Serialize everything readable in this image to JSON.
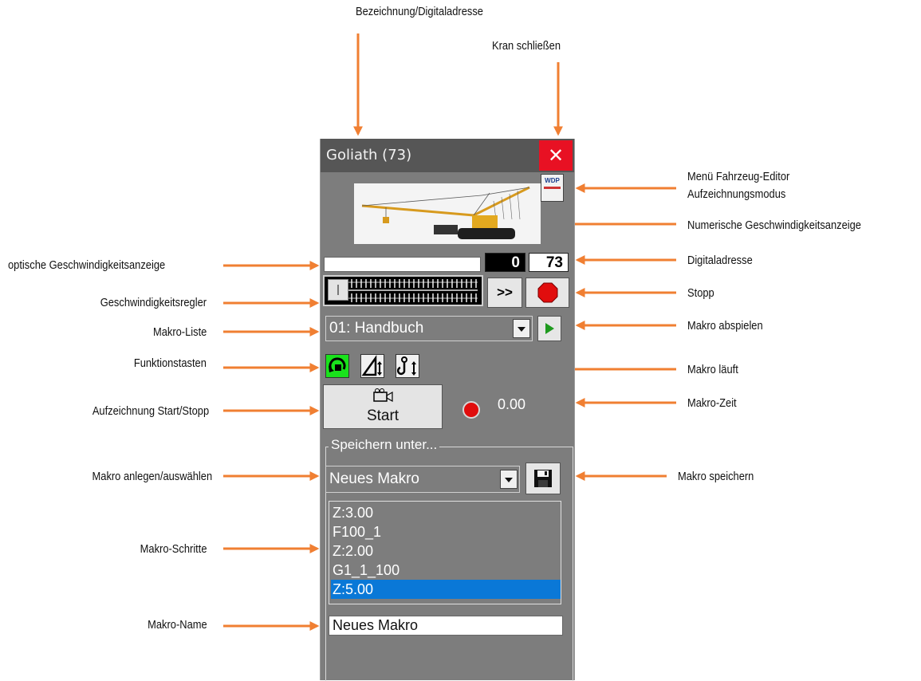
{
  "window": {
    "title": "Goliath  (73)",
    "close_label": "✕",
    "logo_text": "WDP",
    "speed_value": "0",
    "digital_address": "73",
    "slider_level": 0,
    "fast_forward_label": ">>",
    "macro_list": {
      "selected": "01: Handbuch"
    },
    "record": {
      "icon": "camera-icon",
      "label": "Start"
    },
    "macro_time": "0.00",
    "save_group": {
      "label": "Speichern unter...",
      "macro_select": "Neues Makro",
      "steps": [
        "Z:3.00",
        "F100_1",
        "Z:2.00",
        "G1_1_100",
        "Z:5.00"
      ],
      "selected_step_index": 4,
      "name_value": "Neues Makro"
    }
  },
  "annotations": {
    "top_name": "Bezeichnung/Digitaladresse",
    "top_close": "Kran schließen",
    "menu_editor": "Menü Fahrzeug-Editor",
    "record_mode": "Aufzeichnungsmodus",
    "numeric_speed": "Numerische Geschwindigkeitsanzeige",
    "optical_speed": "optische Geschwindigkeitsanzeige",
    "digital_address": "Digitaladresse",
    "speed_controller": "Geschwindigkeitsregler",
    "stop": "Stopp",
    "macro_list": "Makro-Liste",
    "macro_play": "Makro abspielen",
    "function_keys": "Funktionstasten",
    "macro_running": "Makro läuft",
    "record_start_stop": "Aufzeichnung Start/Stopp",
    "macro_time": "Makro-Zeit",
    "macro_create": "Makro anlegen/auswählen",
    "macro_save": "Makro speichern",
    "macro_steps": "Makro-Schritte",
    "macro_name": "Makro-Name"
  },
  "colors": {
    "arrow": "#f07f32",
    "window_bg": "#7d7d7d",
    "titlebar": "#565656",
    "close": "#e81123",
    "selection": "#0a78d7",
    "function_key_active": "#19e21b"
  }
}
